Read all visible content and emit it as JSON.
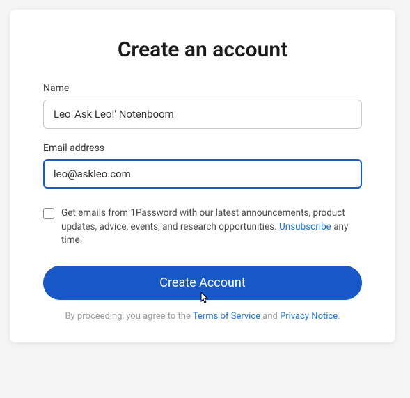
{
  "title": "Create an account",
  "name_field": {
    "label": "Name",
    "value": "Leo 'Ask Leo!' Notenboom"
  },
  "email_field": {
    "label": "Email address",
    "value": "leo@askleo.com"
  },
  "consent": {
    "text_before": "Get emails from 1Password with our latest announcements, product updates, advice, events, and research opportunities. ",
    "unsubscribe": "Unsubscribe",
    "text_after": " any time."
  },
  "submit_label": "Create Account",
  "legal": {
    "prefix": "By proceeding, you agree to the ",
    "tos": "Terms of Service",
    "mid": " and ",
    "privacy": "Privacy Notice",
    "suffix": "."
  }
}
